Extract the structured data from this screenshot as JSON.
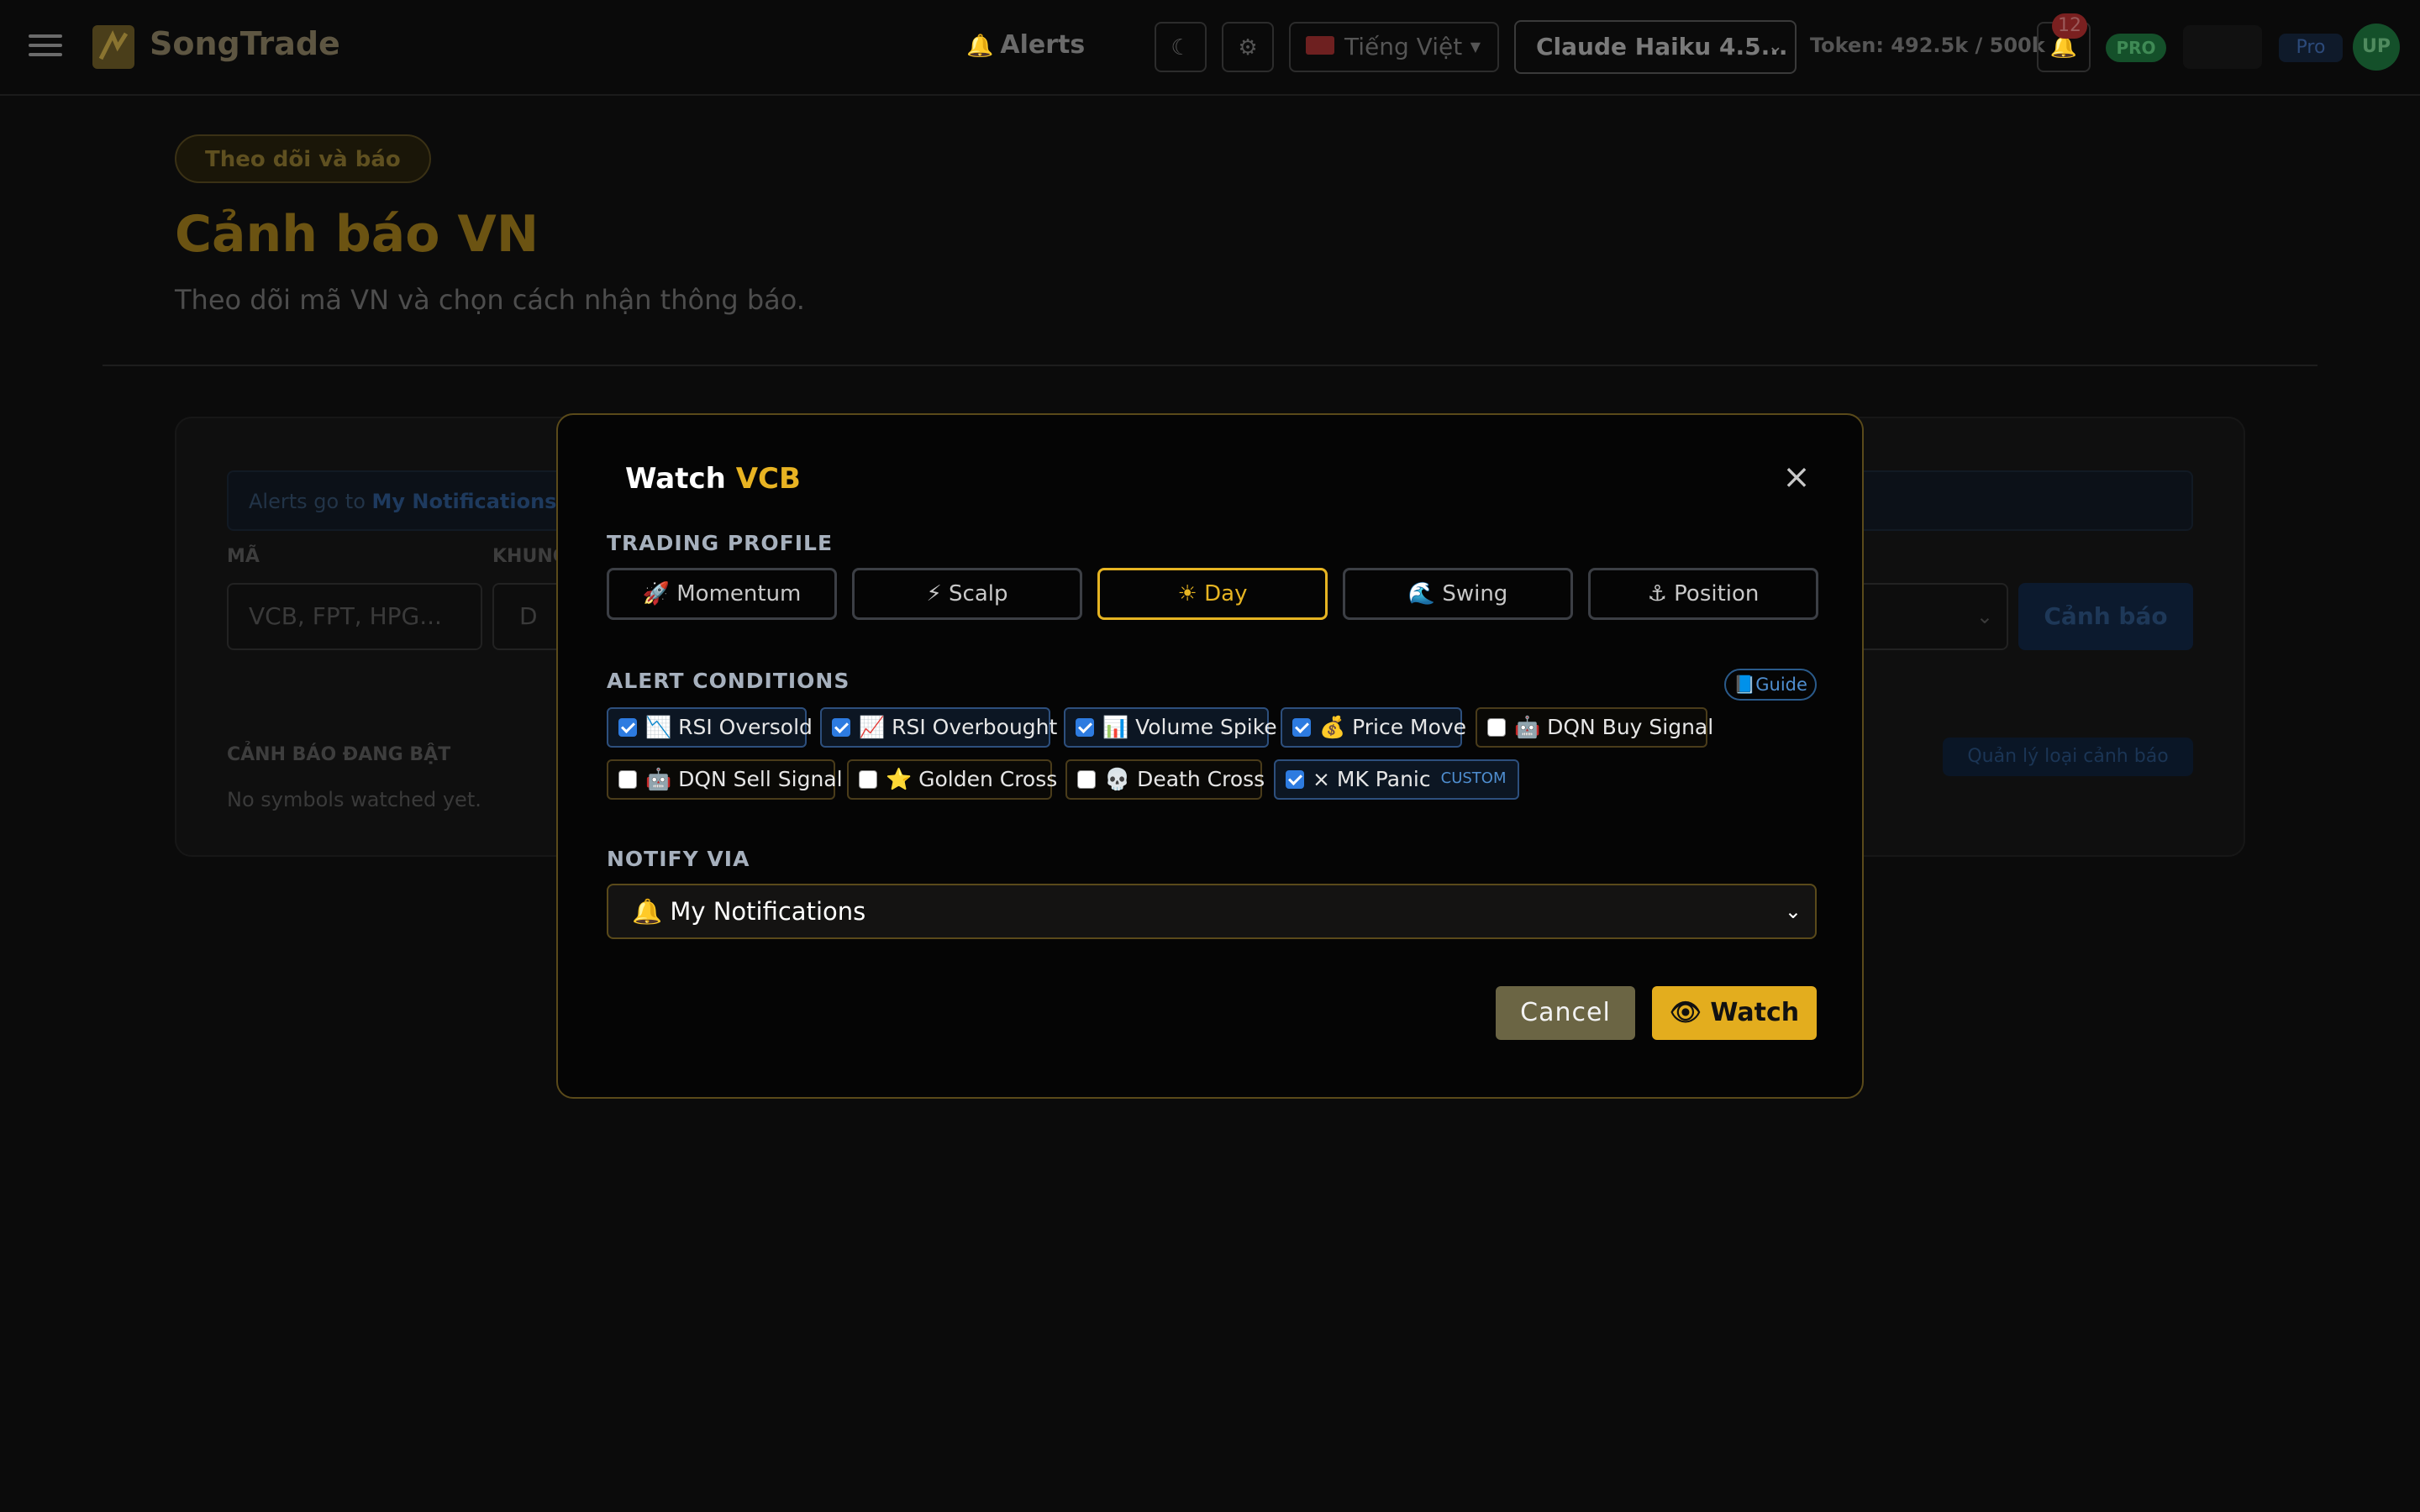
{
  "topbar": {
    "brand": "SongTrade",
    "nav_alerts": "Alerts",
    "nav_alerts_icon": "bell-icon",
    "language": "Tiếng Việt",
    "model": "Claude Haiku 4.5...",
    "tokens": "Token: 492.5k / 500k",
    "notification_count": "12",
    "plan_badge": "PRO",
    "plan_tag": "Pro",
    "avatar": "UP"
  },
  "header": {
    "chip": "Theo dõi và báo",
    "title": "Cảnh báo VN",
    "subtitle": "Theo dõi mã VN và chọn cách nhận thông báo."
  },
  "background_card": {
    "info_prefix": "Alerts go to ",
    "info_link": "My Notifications",
    "label_symbol": "MÃ",
    "label_timeframe": "KHUNG",
    "symbol_placeholder": "VCB, FPT, HPG...",
    "timeframe_value": "D",
    "submit_label": "Cảnh báo",
    "active_title": "CẢNH BÁO ĐANG BẬT",
    "empty_text": "No symbols watched yet.",
    "manage_label": "Quản lý loại cảnh báo"
  },
  "modal": {
    "title_prefix": "Watch ",
    "symbol": "VCB",
    "close_glyph": "×",
    "profile_label": "TRADING PROFILE",
    "profiles": [
      {
        "label": "Momentum",
        "icon": "rocket-icon",
        "active": false
      },
      {
        "label": "⚡ Scalp",
        "icon": "lightning-icon",
        "active": false
      },
      {
        "label": "Day",
        "icon": "sun-icon",
        "active": true
      },
      {
        "label": "Swing",
        "icon": "wave-icon",
        "active": false
      },
      {
        "label": "Position",
        "icon": "anchor-icon",
        "active": false
      }
    ],
    "conditions_label": "ALERT CONDITIONS",
    "guide_label": "Guide",
    "conditions": [
      {
        "label": "RSI Oversold",
        "checked": true
      },
      {
        "label": "RSI Overbought",
        "checked": true
      },
      {
        "label": "Volume Spike",
        "checked": true
      },
      {
        "label": "Price Move",
        "checked": true
      },
      {
        "label": "DQN Buy Signal",
        "checked": false
      },
      {
        "label": "DQN Sell Signal",
        "checked": false
      },
      {
        "label": "Golden Cross",
        "checked": false
      },
      {
        "label": "Death Cross",
        "checked": false
      },
      {
        "label": "× MK Panic",
        "checked": true,
        "tag": "CUSTOM"
      }
    ],
    "notify_label": "NOTIFY VIA",
    "notify_value": "My Notifications",
    "cancel_label": "Cancel",
    "watch_label": "Watch"
  }
}
